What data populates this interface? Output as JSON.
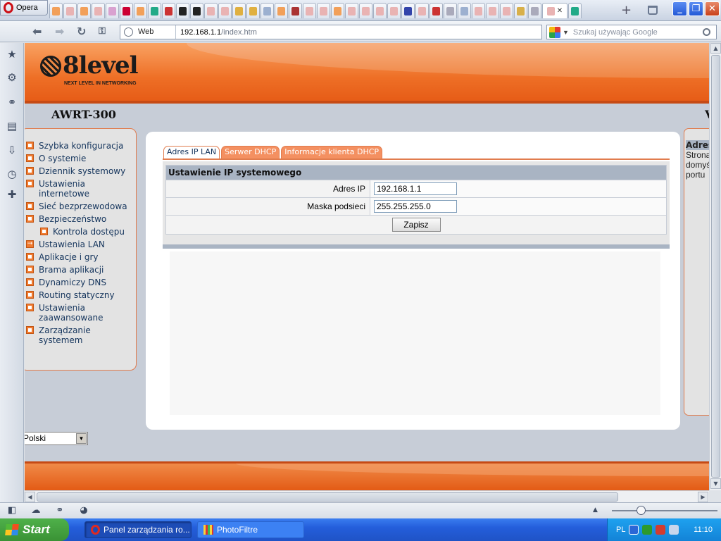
{
  "browser": {
    "menu_label": "Opera",
    "address_label": "Web",
    "url_host": "192.168.1.1",
    "url_path": "/index.htm",
    "search_placeholder": "Szukaj używając Google"
  },
  "router": {
    "logo_text": "8level",
    "logo_tagline": "NEXT LEVEL IN NETWORKING",
    "model": "AWRT-300",
    "model_right": "V"
  },
  "menu": {
    "items": [
      {
        "label": "Szybka konfiguracja"
      },
      {
        "label": "O systemie"
      },
      {
        "label": "Dziennik systemowy"
      },
      {
        "label": "Ustawienia\ninternetowe"
      },
      {
        "label": "Sieć bezprzewodowa"
      },
      {
        "label": "Bezpieczeństwo"
      },
      {
        "label": "Kontrola dostępu"
      },
      {
        "label": "Ustawienia LAN"
      },
      {
        "label": "Aplikacje i gry"
      },
      {
        "label": "Brama aplikacji"
      },
      {
        "label": "Dynamiczy DNS"
      },
      {
        "label": "Routing statyczny"
      },
      {
        "label": "Ustawienia\nzaawansowane"
      },
      {
        "label": "Zarządzanie\nsystemem"
      }
    ],
    "language": "Polski"
  },
  "tabs": [
    {
      "label": "Adres IP LAN",
      "active": true
    },
    {
      "label": "Serwer DHCP",
      "active": false
    },
    {
      "label": "Informacje klienta DHCP",
      "active": false
    }
  ],
  "form": {
    "title": "Ustawienie IP systemowego",
    "ip_label": "Adres IP",
    "ip_value": "192.168.1.1",
    "mask_label": "Maska podsieci",
    "mask_value": "255.255.255.0",
    "save_label": "Zapisz"
  },
  "help": {
    "title": "Adres",
    "text": "Strona\ndomyś\nportu"
  },
  "taskbar": {
    "start_label": "Start",
    "task_opera": "Panel zarządzania ro...",
    "task_photo": "PhotoFiltre",
    "lang": "PL",
    "time": "11:10"
  },
  "colors": {
    "accent_orange": "#ee6f26",
    "menu_text": "#14345c",
    "table_header": "#a9b4c3"
  }
}
